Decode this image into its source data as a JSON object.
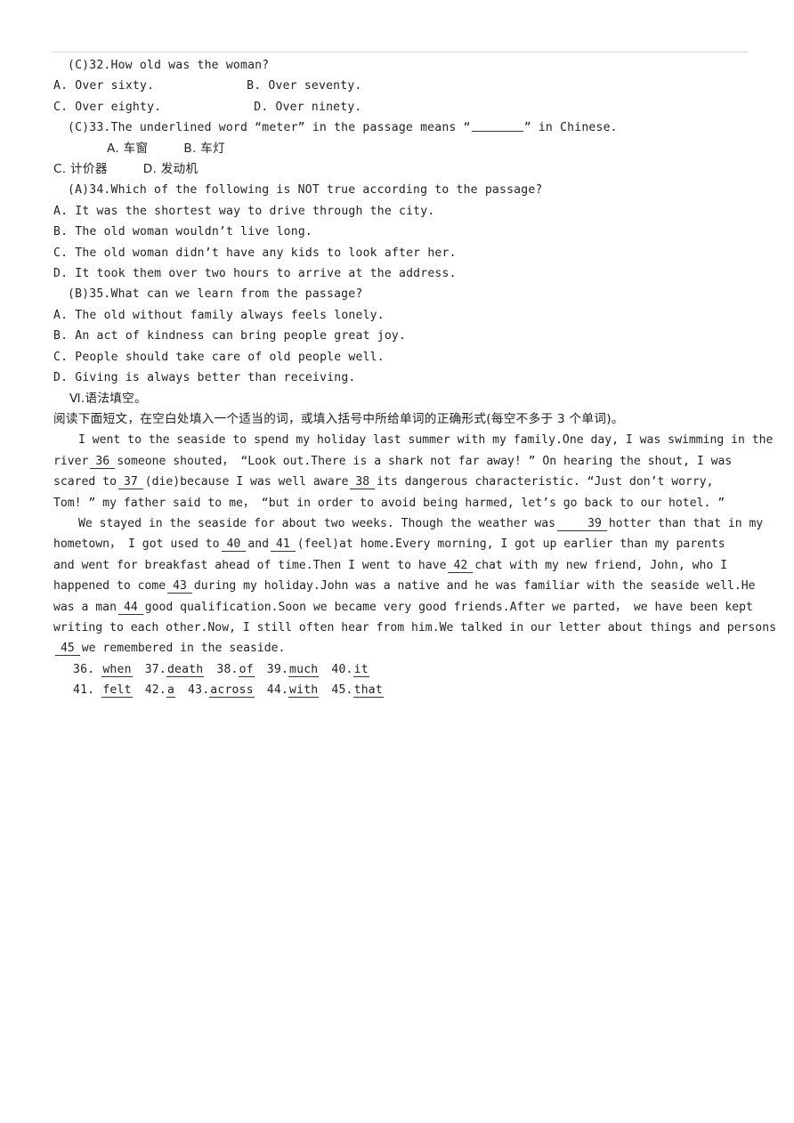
{
  "document": {
    "divider": "horizontal-rule",
    "reading_questions": [
      {
        "marker": "(C)",
        "number": "32.",
        "stem": "How old was the woman?",
        "options_rows": [
          {
            "left": "A. Over sixty.",
            "right": "B. Over seventy."
          },
          {
            "left": "C. Over eighty.",
            "right": "D. Over ninety."
          }
        ]
      },
      {
        "marker": "(C)",
        "number": "33.",
        "stem_part1": "The underlined word ",
        "stem_quoted": "“meter”",
        "stem_part2": " in the passage means  “",
        "stem_part3": "”  in Chinese.",
        "options_rows": [
          {
            "left": "A. 车窗",
            "right": "B. 车灯"
          },
          {
            "left": "C. 计价器",
            "right": "D. 发动机"
          }
        ]
      },
      {
        "marker": "(A)",
        "number": "34.",
        "stem": "Which of the following is NOT true according to the passage?",
        "options": [
          "A. It was the shortest way to drive through the city.",
          "B. The old woman wouldn’t live long.",
          "C. The old woman didn’t have any kids to look after her.",
          "D. It took them over two hours to arrive at the address."
        ]
      },
      {
        "marker": "(B)",
        "number": "35.",
        "stem": "What can we learn from the passage?",
        "options": [
          "A. The old without family always feels lonely.",
          "B. An act of kindness can bring people great joy.",
          "C. People should take care of old people well.",
          "D. Giving is always better than receiving."
        ]
      }
    ],
    "section": {
      "roman": "Ⅵ.",
      "title": "语法填空。",
      "instruction": "阅读下面短文，在空白处填入一个适当的词，或填入括号中所给单词的正确形式(每空不多于 3 个单词)。"
    },
    "cloze_lines": [
      {
        "id": "line-1",
        "indent": true,
        "segments": [
          {
            "type": "text",
            "value": "I went to the seaside to spend my holiday last summer with my family.One day, I was swimming in the"
          }
        ]
      },
      {
        "id": "line-2",
        "indent": false,
        "segments": [
          {
            "type": "text",
            "value": "river"
          },
          {
            "type": "blank",
            "value": "36"
          },
          {
            "type": "text",
            "value": "someone shouted， “Look out.There is a shark not far away! ” On hearing the shout, I was"
          }
        ]
      },
      {
        "id": "line-3",
        "indent": false,
        "segments": [
          {
            "type": "text",
            "value": "scared to"
          },
          {
            "type": "blank",
            "value": "37"
          },
          {
            "type": "text",
            "value": "(die)because I was well aware"
          },
          {
            "type": "blank",
            "value": "38"
          },
          {
            "type": "text",
            "value": "its dangerous characteristic. “Just don’t worry,"
          }
        ]
      },
      {
        "id": "line-4",
        "indent": false,
        "segments": [
          {
            "type": "text",
            "value": "Tom! ”  my father said to me， “but in order to avoid being harmed, let’s go back to our hotel. ”"
          }
        ]
      },
      {
        "id": "line-5",
        "indent": true,
        "segments": [
          {
            "type": "text",
            "value": "We stayed in the seaside for about two weeks. Though the weather was"
          },
          {
            "type": "blank",
            "value": "39"
          },
          {
            "type": "text",
            "value": "hotter than that in my"
          }
        ]
      },
      {
        "id": "line-6",
        "indent": false,
        "segments": [
          {
            "type": "text",
            "value": "hometown， I got used to"
          },
          {
            "type": "blank",
            "value": "40"
          },
          {
            "type": "text",
            "value": "and"
          },
          {
            "type": "blank",
            "value": "41"
          },
          {
            "type": "text",
            "value": "(feel)at home.Every morning, I got up earlier than my parents"
          }
        ]
      },
      {
        "id": "line-7",
        "indent": false,
        "segments": [
          {
            "type": "text",
            "value": "and went for breakfast ahead of time.Then I went to have"
          },
          {
            "type": "blank",
            "value": "42"
          },
          {
            "type": "text",
            "value": "chat with my new friend, John, who I"
          }
        ]
      },
      {
        "id": "line-8",
        "indent": false,
        "segments": [
          {
            "type": "text",
            "value": "happened to come"
          },
          {
            "type": "blank",
            "value": "43"
          },
          {
            "type": "text",
            "value": "during my holiday.John was a native and he was familiar with the seaside well.He"
          }
        ]
      },
      {
        "id": "line-9",
        "indent": false,
        "segments": [
          {
            "type": "text",
            "value": "was a man"
          },
          {
            "type": "blank",
            "value": "44"
          },
          {
            "type": "text",
            "value": "good qualification.Soon we became very good friends.After we parted， we have been kept"
          }
        ]
      },
      {
        "id": "line-10",
        "indent": false,
        "segments": [
          {
            "type": "text",
            "value": "writing to each other.Now, I still often hear from him.We talked in our letter about things and persons"
          }
        ]
      },
      {
        "id": "line-11",
        "indent": false,
        "segments": [
          {
            "type": "blank",
            "value": "45"
          },
          {
            "type": "text",
            "value": "we remembered in the seaside."
          }
        ]
      }
    ],
    "answer_key": [
      [
        {
          "num": "36.",
          "answer": "when"
        },
        {
          "num": "37.",
          "answer": "death"
        },
        {
          "num": "38.",
          "answer": "of"
        },
        {
          "num": "39.",
          "answer": "much"
        },
        {
          "num": "40.",
          "answer": "it"
        }
      ],
      [
        {
          "num": "41.",
          "answer": "felt"
        },
        {
          "num": "42.",
          "answer": "a"
        },
        {
          "num": "43.",
          "answer": "across"
        },
        {
          "num": "44.",
          "answer": "with"
        },
        {
          "num": "45.",
          "answer": "that"
        }
      ]
    ]
  }
}
